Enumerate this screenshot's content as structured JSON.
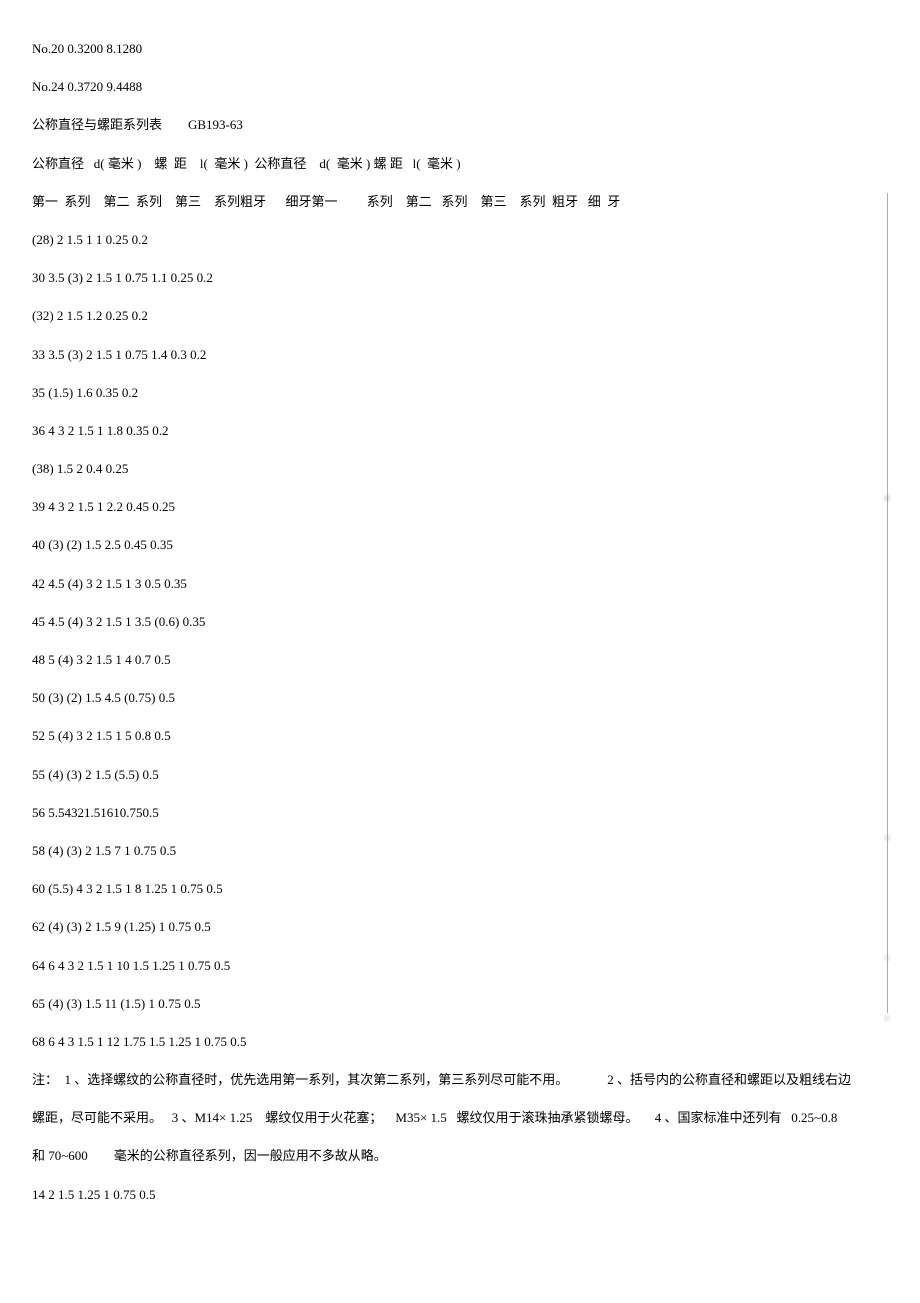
{
  "pre_lines": [
    "No.20 0.3200 8.1280",
    "No.24 0.3720 9.4488",
    "公称直径与螺距系列表  GB193-63",
    "公称直径   d( 毫米 )    螺  距    l(  毫米 )  公称直径    d(  毫米 ) 螺 距   l(  毫米 )"
  ],
  "boxed_lines": [
    "第一  系列    第二  系列    第三    系列粗牙      细牙第一         系列    第二   系列    第三    系列  粗牙   细  牙",
    "(28) 2 1.5 1 1 0.25 0.2",
    "30 3.5 (3) 2 1.5 1 0.75 1.1 0.25 0.2",
    "(32) 2 1.5 1.2 0.25 0.2",
    "33 3.5 (3) 2 1.5 1 0.75 1.4 0.3 0.2",
    "35 (1.5) 1.6 0.35 0.2",
    "36 4 3 2 1.5 1 1.8 0.35 0.2",
    "(38) 1.5 2 0.4 0.25",
    "39 4 3 2 1.5 1 2.2 0.45 0.25",
    "40 (3) (2) 1.5 2.5 0.45 0.35",
    "42 4.5 (4) 3 2 1.5 1 3 0.5 0.35",
    "45 4.5 (4) 3 2 1.5 1 3.5 (0.6) 0.35",
    "48 5 (4) 3 2 1.5 1 4 0.7 0.5",
    "50 (3) (2) 1.5 4.5 (0.75) 0.5",
    "52 5 (4) 3 2 1.5 1 5 0.8 0.5",
    "55 (4) (3) 2 1.5 (5.5) 0.5",
    "56 5.54321.51610.750.5",
    "58 (4) (3) 2 1.5 7 1 0.75 0.5",
    "60 (5.5) 4 3 2 1.5 1 8 1.25 1 0.75 0.5",
    "62 (4) (3) 2 1.5 9 (1.25) 1 0.75 0.5",
    "64 6 4 3 2 1.5 1 10 1.5 1.25 1 0.75 0.5",
    "65 (4) (3) 1.5 11 (1.5) 1 0.75 0.5"
  ],
  "post_lines": [
    "68 6 4 3 1.5 1 12 1.75 1.5 1.25 1 0.75 0.5",
    "注：  1 、选择螺纹的公称直径时，优先选用第一系列，其次第二系列，第三系列尽可能不用。   2 、括号内的公称直径和螺距以及粗线右边",
    "螺距，尽可能不采用。   3 、M14× 1.25    螺纹仅用于火花塞； M35× 1.5   螺纹仅用于滚珠抽承紧锁螺母。  4 、国家标准中还列有   0.25~0.8",
    "和 70~600  毫米的公称直径系列，因一般应用不多故从略。",
    "14 2 1.5 1.25 1 0.75 0.5"
  ]
}
